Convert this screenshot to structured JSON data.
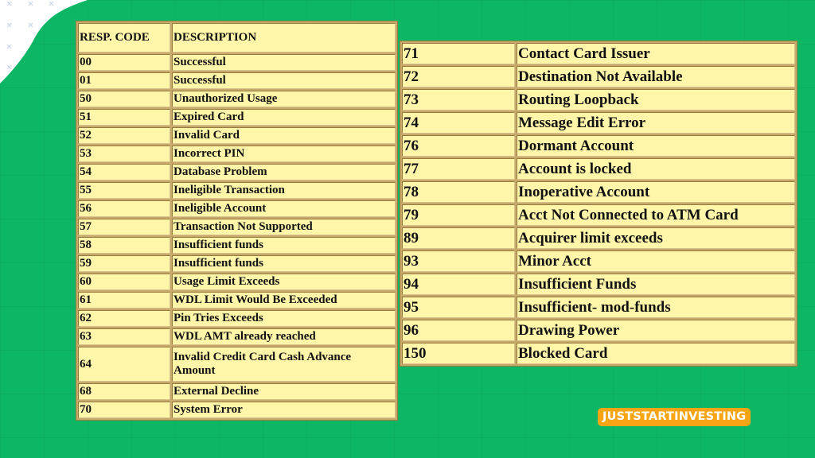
{
  "left_table": {
    "headers": {
      "code": "RESP. CODE",
      "description": "DESCRIPTION"
    },
    "rows": [
      {
        "code": "00",
        "description": "Successful"
      },
      {
        "code": "01",
        "description": "Successful"
      },
      {
        "code": "50",
        "description": "Unauthorized Usage"
      },
      {
        "code": "51",
        "description": "Expired Card"
      },
      {
        "code": "52",
        "description": "Invalid Card"
      },
      {
        "code": "53",
        "description": "Incorrect PIN"
      },
      {
        "code": "54",
        "description": "Database Problem"
      },
      {
        "code": "55",
        "description": "Ineligible Transaction"
      },
      {
        "code": "56",
        "description": "Ineligible Account"
      },
      {
        "code": "57",
        "description": "Transaction Not Supported"
      },
      {
        "code": "58",
        "description": "Insufficient funds"
      },
      {
        "code": "59",
        "description": "Insufficient funds"
      },
      {
        "code": "60",
        "description": "Usage Limit Exceeds"
      },
      {
        "code": "61",
        "description": "WDL Limit Would Be Exceeded"
      },
      {
        "code": "62",
        "description": "Pin Tries Exceeds"
      },
      {
        "code": "63",
        "description": "WDL AMT already reached"
      },
      {
        "code": "64",
        "description": "Invalid Credit Card Cash Advance Amount"
      },
      {
        "code": "68",
        "description": "External Decline"
      },
      {
        "code": "70",
        "description": "System Error"
      }
    ]
  },
  "right_table": {
    "rows": [
      {
        "code": "71",
        "description": "Contact Card Issuer"
      },
      {
        "code": "72",
        "description": "Destination Not Available"
      },
      {
        "code": "73",
        "description": "Routing Loopback"
      },
      {
        "code": "74",
        "description": "Message Edit Error"
      },
      {
        "code": "76",
        "description": "Dormant Account"
      },
      {
        "code": "77",
        "description": "Account is locked"
      },
      {
        "code": "78",
        "description": "Inoperative Account"
      },
      {
        "code": "79",
        "description": "Acct Not Connected to ATM Card"
      },
      {
        "code": "89",
        "description": "Acquirer limit exceeds"
      },
      {
        "code": "93",
        "description": "Minor Acct"
      },
      {
        "code": "94",
        "description": "Insufficient Funds"
      },
      {
        "code": "95",
        "description": "Insufficient- mod-funds"
      },
      {
        "code": "96",
        "description": "Drawing Power"
      },
      {
        "code": "150",
        "description": "Blocked Card"
      }
    ]
  },
  "brand": {
    "label": "JUSTSTARTINVESTING"
  },
  "colors": {
    "background": "#0db665",
    "cell": "#fff6a9",
    "border": "#a88a4e",
    "brand_badge": "#f7a415"
  }
}
